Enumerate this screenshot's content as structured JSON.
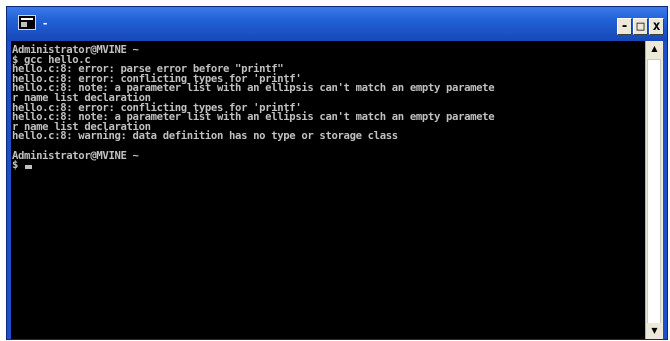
{
  "window": {
    "title": "-",
    "controls": {
      "minimize": "-",
      "maximize": "□",
      "close": "x"
    }
  },
  "console": {
    "lines": [
      "Administrator@MVINE ~",
      "$ gcc hello.c",
      "hello.c:8: error: parse error before \"printf\"",
      "hello.c:8: error: conflicting types for 'printf'",
      "hello.c:8: note: a parameter list with an ellipsis can't match an empty paramete",
      "r name list declaration",
      "hello.c:8: error: conflicting types for 'printf'",
      "hello.c:8: note: a parameter list with an ellipsis can't match an empty paramete",
      "r name list declaration",
      "hello.c:8: warning: data definition has no type or storage class",
      "",
      "Administrator@MVINE ~",
      "$ "
    ]
  },
  "scrollbar": {
    "up_arrow": "▲",
    "down_arrow": "▼"
  },
  "icons": {
    "app": "console-app-icon",
    "cursor": "text-cursor-block"
  },
  "colors": {
    "titlebar": "#2160d6",
    "console_bg": "#000000",
    "console_fg": "#c0c0c0"
  }
}
